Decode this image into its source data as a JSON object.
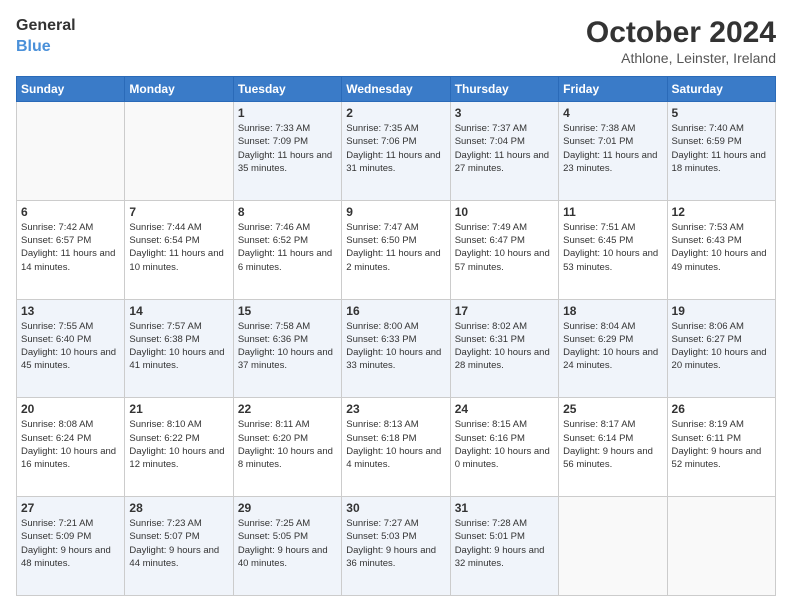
{
  "logo": {
    "line1": "General",
    "line2": "Blue"
  },
  "title": "October 2024",
  "location": "Athlone, Leinster, Ireland",
  "days_of_week": [
    "Sunday",
    "Monday",
    "Tuesday",
    "Wednesday",
    "Thursday",
    "Friday",
    "Saturday"
  ],
  "weeks": [
    [
      {
        "day": "",
        "info": ""
      },
      {
        "day": "",
        "info": ""
      },
      {
        "day": "1",
        "info": "Sunrise: 7:33 AM\nSunset: 7:09 PM\nDaylight: 11 hours and 35 minutes."
      },
      {
        "day": "2",
        "info": "Sunrise: 7:35 AM\nSunset: 7:06 PM\nDaylight: 11 hours and 31 minutes."
      },
      {
        "day": "3",
        "info": "Sunrise: 7:37 AM\nSunset: 7:04 PM\nDaylight: 11 hours and 27 minutes."
      },
      {
        "day": "4",
        "info": "Sunrise: 7:38 AM\nSunset: 7:01 PM\nDaylight: 11 hours and 23 minutes."
      },
      {
        "day": "5",
        "info": "Sunrise: 7:40 AM\nSunset: 6:59 PM\nDaylight: 11 hours and 18 minutes."
      }
    ],
    [
      {
        "day": "6",
        "info": "Sunrise: 7:42 AM\nSunset: 6:57 PM\nDaylight: 11 hours and 14 minutes."
      },
      {
        "day": "7",
        "info": "Sunrise: 7:44 AM\nSunset: 6:54 PM\nDaylight: 11 hours and 10 minutes."
      },
      {
        "day": "8",
        "info": "Sunrise: 7:46 AM\nSunset: 6:52 PM\nDaylight: 11 hours and 6 minutes."
      },
      {
        "day": "9",
        "info": "Sunrise: 7:47 AM\nSunset: 6:50 PM\nDaylight: 11 hours and 2 minutes."
      },
      {
        "day": "10",
        "info": "Sunrise: 7:49 AM\nSunset: 6:47 PM\nDaylight: 10 hours and 57 minutes."
      },
      {
        "day": "11",
        "info": "Sunrise: 7:51 AM\nSunset: 6:45 PM\nDaylight: 10 hours and 53 minutes."
      },
      {
        "day": "12",
        "info": "Sunrise: 7:53 AM\nSunset: 6:43 PM\nDaylight: 10 hours and 49 minutes."
      }
    ],
    [
      {
        "day": "13",
        "info": "Sunrise: 7:55 AM\nSunset: 6:40 PM\nDaylight: 10 hours and 45 minutes."
      },
      {
        "day": "14",
        "info": "Sunrise: 7:57 AM\nSunset: 6:38 PM\nDaylight: 10 hours and 41 minutes."
      },
      {
        "day": "15",
        "info": "Sunrise: 7:58 AM\nSunset: 6:36 PM\nDaylight: 10 hours and 37 minutes."
      },
      {
        "day": "16",
        "info": "Sunrise: 8:00 AM\nSunset: 6:33 PM\nDaylight: 10 hours and 33 minutes."
      },
      {
        "day": "17",
        "info": "Sunrise: 8:02 AM\nSunset: 6:31 PM\nDaylight: 10 hours and 28 minutes."
      },
      {
        "day": "18",
        "info": "Sunrise: 8:04 AM\nSunset: 6:29 PM\nDaylight: 10 hours and 24 minutes."
      },
      {
        "day": "19",
        "info": "Sunrise: 8:06 AM\nSunset: 6:27 PM\nDaylight: 10 hours and 20 minutes."
      }
    ],
    [
      {
        "day": "20",
        "info": "Sunrise: 8:08 AM\nSunset: 6:24 PM\nDaylight: 10 hours and 16 minutes."
      },
      {
        "day": "21",
        "info": "Sunrise: 8:10 AM\nSunset: 6:22 PM\nDaylight: 10 hours and 12 minutes."
      },
      {
        "day": "22",
        "info": "Sunrise: 8:11 AM\nSunset: 6:20 PM\nDaylight: 10 hours and 8 minutes."
      },
      {
        "day": "23",
        "info": "Sunrise: 8:13 AM\nSunset: 6:18 PM\nDaylight: 10 hours and 4 minutes."
      },
      {
        "day": "24",
        "info": "Sunrise: 8:15 AM\nSunset: 6:16 PM\nDaylight: 10 hours and 0 minutes."
      },
      {
        "day": "25",
        "info": "Sunrise: 8:17 AM\nSunset: 6:14 PM\nDaylight: 9 hours and 56 minutes."
      },
      {
        "day": "26",
        "info": "Sunrise: 8:19 AM\nSunset: 6:11 PM\nDaylight: 9 hours and 52 minutes."
      }
    ],
    [
      {
        "day": "27",
        "info": "Sunrise: 7:21 AM\nSunset: 5:09 PM\nDaylight: 9 hours and 48 minutes."
      },
      {
        "day": "28",
        "info": "Sunrise: 7:23 AM\nSunset: 5:07 PM\nDaylight: 9 hours and 44 minutes."
      },
      {
        "day": "29",
        "info": "Sunrise: 7:25 AM\nSunset: 5:05 PM\nDaylight: 9 hours and 40 minutes."
      },
      {
        "day": "30",
        "info": "Sunrise: 7:27 AM\nSunset: 5:03 PM\nDaylight: 9 hours and 36 minutes."
      },
      {
        "day": "31",
        "info": "Sunrise: 7:28 AM\nSunset: 5:01 PM\nDaylight: 9 hours and 32 minutes."
      },
      {
        "day": "",
        "info": ""
      },
      {
        "day": "",
        "info": ""
      }
    ]
  ]
}
